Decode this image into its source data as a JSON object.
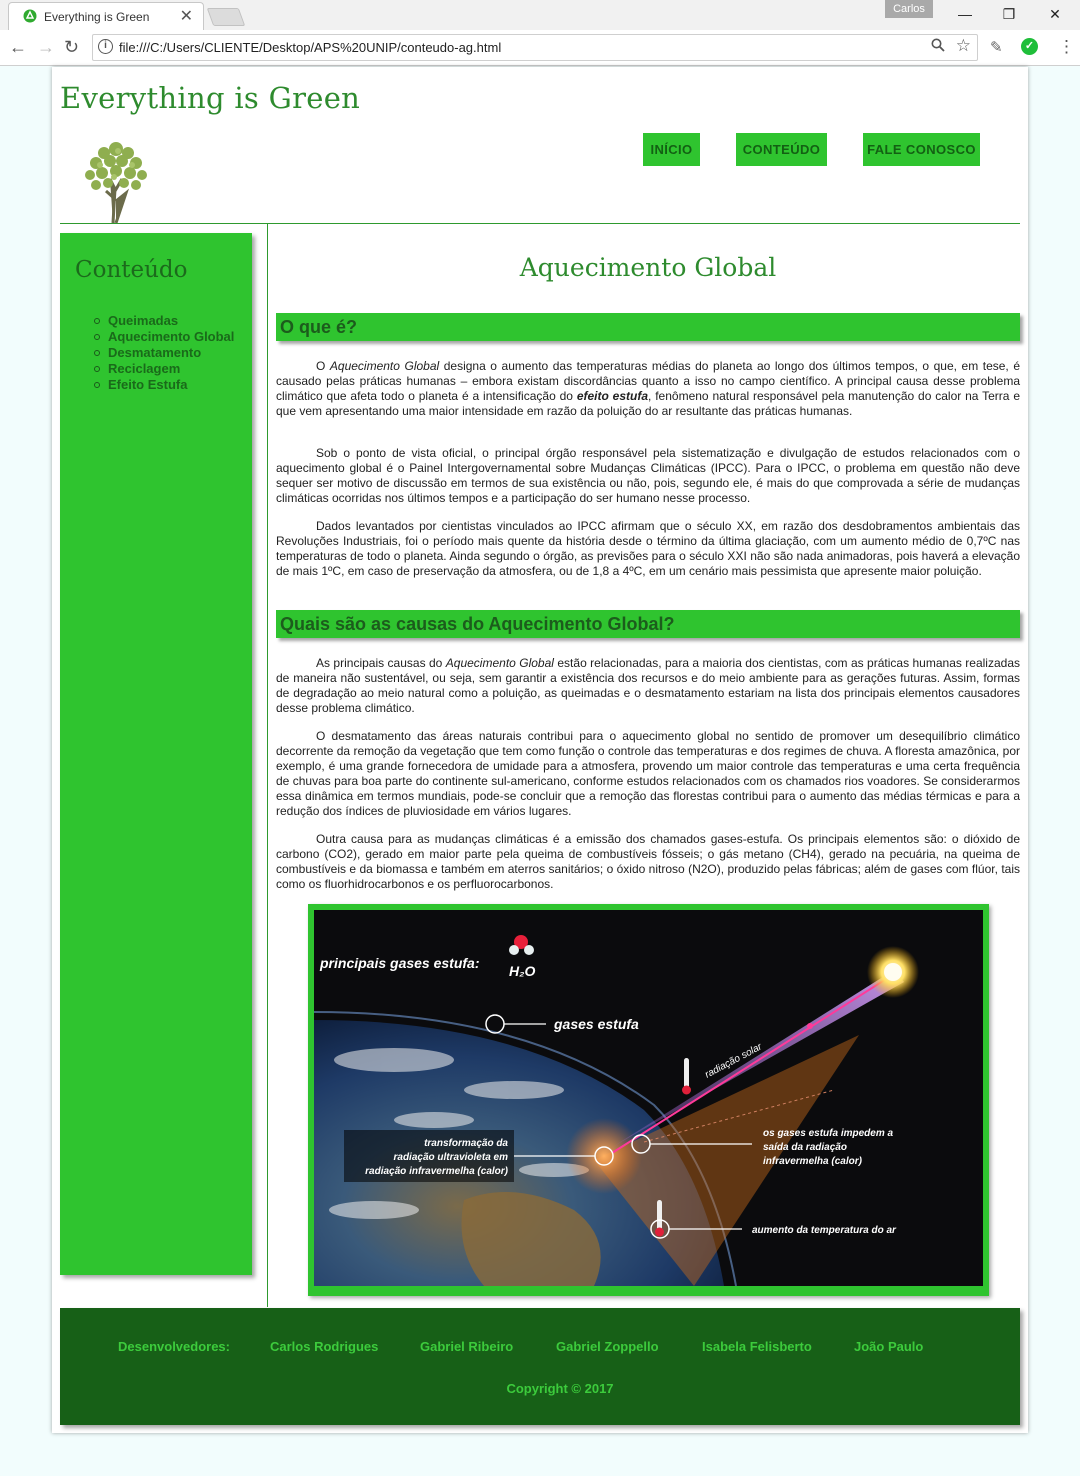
{
  "browser": {
    "tab_title": "Everything is Green",
    "tab_close": "✕",
    "profile_name": "Carlos",
    "url": "file:///C:/Users/CLIENTE/Desktop/APS%20UNIP/conteudo-ag.html",
    "window_buttons": {
      "minimize": "—",
      "restore": "❐",
      "close": "✕"
    }
  },
  "site": {
    "title": "Everything is Green",
    "nav": [
      "INÍCIO",
      "CONTEÚDO",
      "FALE CONOSCO"
    ]
  },
  "sidebar": {
    "title": "Conteúdo",
    "items": [
      "Queimadas",
      "Aquecimento Global",
      "Desmatamento",
      "Reciclagem",
      "Efeito Estufa"
    ]
  },
  "article": {
    "title": "Aquecimento Global",
    "section1": {
      "heading": "O que é?",
      "p1_a": "O ",
      "p1_term": "Aquecimento Global",
      "p1_b": " designa o aumento das temperaturas médias do planeta ao longo dos últimos tempos, o que, em tese, é causado pelas práticas humanas – embora existam discordâncias quanto a isso no campo científico. A principal causa desse problema climático que afeta todo o planeta é a intensificação do ",
      "p1_bold": "efeito estufa",
      "p1_c": ", fenômeno natural responsável pela manutenção do calor na Terra e que vem apresentando uma maior intensidade em razão da poluição do ar resultante das práticas humanas.",
      "p2": "Sob o ponto de vista oficial, o principal órgão responsável pela sistematização e divulgação de estudos relacionados com o aquecimento global é o Painel Intergovernamental sobre Mudanças Climáticas (IPCC). Para o IPCC, o problema em questão não deve sequer ser motivo de discussão em termos de sua existência ou não, pois, segundo ele, é mais do que comprovada a série de mudanças climáticas ocorridas nos últimos tempos e a participação do ser humano nesse processo.",
      "p3": "Dados levantados por cientistas vinculados ao IPCC afirmam que o século XX, em razão dos desdobramentos ambientais das Revoluções Industriais, foi o período mais quente da história desde o término da última glaciação, com um aumento médio de 0,7ºC nas temperaturas de todo o planeta. Ainda segundo o órgão, as previsões para o século XXI não são nada animadoras, pois haverá a elevação de mais 1ºC, em caso de preservação da atmosfera, ou de 1,8 a 4ºC, em um cenário mais pessimista que apresente maior poluição."
    },
    "section2": {
      "heading": "Quais são as causas do Aquecimento Global?",
      "p1_a": "As principais causas do ",
      "p1_term": "Aquecimento Global",
      "p1_b": " estão relacionadas, para a maioria dos cientistas, com as práticas humanas realizadas de maneira não sustentável, ou seja, sem garantir a existência dos recursos e do meio ambiente para as gerações futuras. Assim, formas de degradação ao meio natural como a poluição, as queimadas e o desmatamento estariam na lista dos principais elementos causadores desse problema climático.",
      "p2": "O desmatamento das áreas naturais contribui para o aquecimento global no sentido de promover um desequilíbrio climático decorrente da remoção da vegetação que tem como função o controle das temperaturas e dos regimes de chuva. A floresta amazônica, por exemplo, é uma grande fornecedora de umidade para a atmosfera, provendo um maior controle das temperaturas e uma certa frequência de chuvas para boa parte do continente sul-americano, conforme estudos relacionados com os chamados rios voadores. Se considerarmos essa dinâmica em termos mundiais, pode-se concluir que a remoção das florestas contribui para o aumento das médias térmicas e para a redução dos índices de pluviosidade em vários lugares.",
      "p3": "Outra causa para as mudanças climáticas é a emissão dos chamados gases-estufa. Os principais elementos são: o dióxido de carbono (CO2), gerado em maior parte pela queima de combustíveis fósseis; o gás metano (CH4), gerado na pecuária, na queima de combustíveis e da biomassa e também em aterros sanitários; o óxido nitroso (N2O), produzido pelas fábricas; além de gases com flúor, tais como os fluorhidrocarbonos e os perfluorocarbonos."
    },
    "figure": {
      "heading": "principais gases estufa:",
      "formula": "H₂O",
      "label_gases": "gases estufa",
      "label_solar": "radiação solar",
      "label_transform_1": "transformação da",
      "label_transform_2": "radiação ultravioleta em",
      "label_transform_3": "radiação infravermelha (calor)",
      "label_block_1": "os gases estufa impedem a",
      "label_block_2": "saída da radiação",
      "label_block_3": "infravermelha (calor)",
      "label_temp": "aumento da temperatura do ar"
    }
  },
  "footer": {
    "developers_label": "Desenvolvedores:",
    "developers": [
      "Carlos Rodrigues",
      "Gabriel Ribeiro",
      "Gabriel Zoppello",
      "Isabela Felisberto",
      "João Paulo"
    ],
    "copyright": "Copyright © 2017"
  }
}
